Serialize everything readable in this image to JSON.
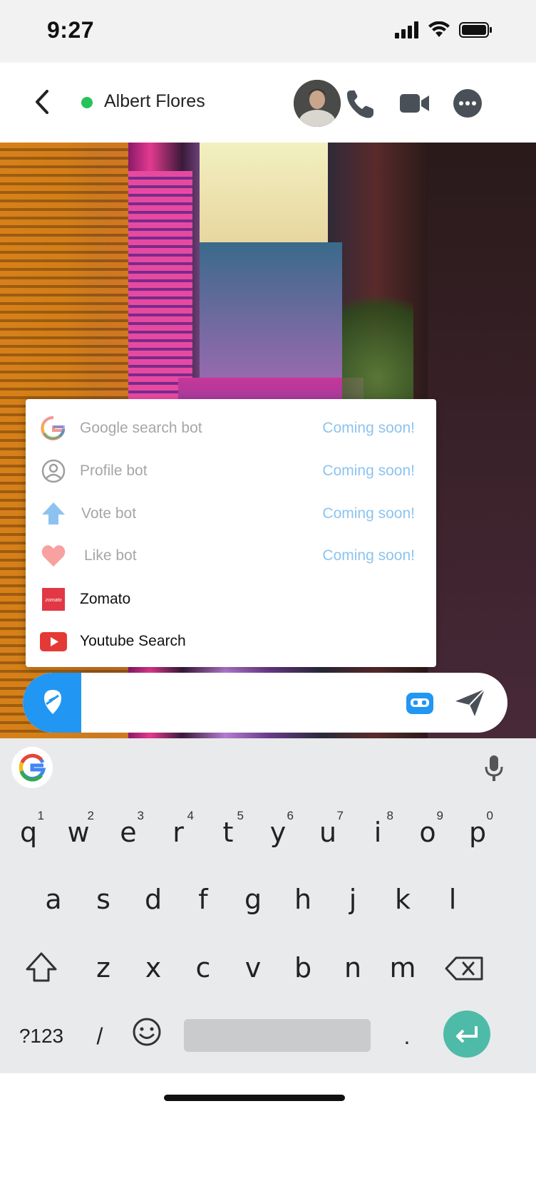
{
  "status_bar": {
    "time": "9:27"
  },
  "header": {
    "contact_name": "Albert Flores",
    "online": true
  },
  "bot_menu": {
    "items": [
      {
        "icon": "google-icon",
        "label": "Google search bot",
        "status": "Coming soon!"
      },
      {
        "icon": "profile-icon",
        "label": "Profile bot",
        "status": "Coming soon!"
      },
      {
        "icon": "upvote-arrow-icon",
        "label": "Vote bot",
        "status": "Coming soon!"
      },
      {
        "icon": "heart-icon",
        "label": "Like bot",
        "status": "Coming soon!"
      },
      {
        "icon": "zomato-icon",
        "label": "Zomato",
        "logo_text": "zomato"
      },
      {
        "icon": "youtube-icon",
        "label": "Youtube Search"
      }
    ]
  },
  "input": {
    "placeholder": ""
  },
  "keyboard": {
    "row1": [
      "q",
      "w",
      "e",
      "r",
      "t",
      "y",
      "u",
      "i",
      "o",
      "p"
    ],
    "row1_hints": [
      "1",
      "2",
      "3",
      "4",
      "5",
      "6",
      "7",
      "8",
      "9",
      "0"
    ],
    "row2": [
      "a",
      "s",
      "d",
      "f",
      "g",
      "h",
      "j",
      "k",
      "l"
    ],
    "row3": [
      "z",
      "x",
      "c",
      "v",
      "b",
      "n",
      "m"
    ],
    "symbols_key": "?123",
    "slash_key": "/",
    "period_key": "."
  },
  "colors": {
    "accent_blue": "#2196f3",
    "online_green": "#27c25a",
    "coming_soon": "#8cc4ef",
    "enter_teal": "#4dbba7",
    "zomato_red": "#e23744",
    "youtube_red": "#e53935"
  }
}
